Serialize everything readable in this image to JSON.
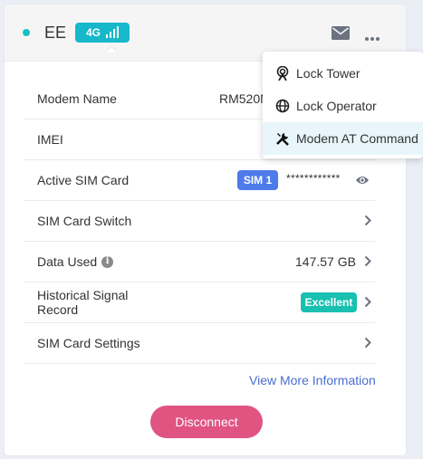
{
  "header": {
    "operator": "EE",
    "network_badge": "4G",
    "signal_bars": 4
  },
  "rows": {
    "modem_name": {
      "label": "Modem Name",
      "value": "RM520N"
    },
    "imei": {
      "label": "IMEI"
    },
    "active_sim": {
      "label": "Active SIM Card",
      "badge": "SIM 1",
      "masked": "************"
    },
    "sim_switch": {
      "label": "SIM Card Switch"
    },
    "data_used": {
      "label": "Data Used",
      "value": "147.57 GB"
    },
    "signal_record": {
      "label": "Historical Signal Record",
      "badge": "Excellent"
    },
    "sim_settings": {
      "label": "SIM Card Settings"
    }
  },
  "view_more": "View More Information",
  "disconnect": "Disconnect",
  "menu": {
    "items": [
      {
        "label": "Lock Tower",
        "icon": "tower-icon"
      },
      {
        "label": "Lock Operator",
        "icon": "globe-icon"
      },
      {
        "label": "Modem AT Command",
        "icon": "tools-icon"
      }
    ]
  },
  "colors": {
    "accent_teal": "#17b8c9",
    "sim_blue": "#4e7bea",
    "excellent_green": "#18c0b0",
    "disconnect_pink": "#e05482",
    "link_blue": "#4a6fd1"
  }
}
